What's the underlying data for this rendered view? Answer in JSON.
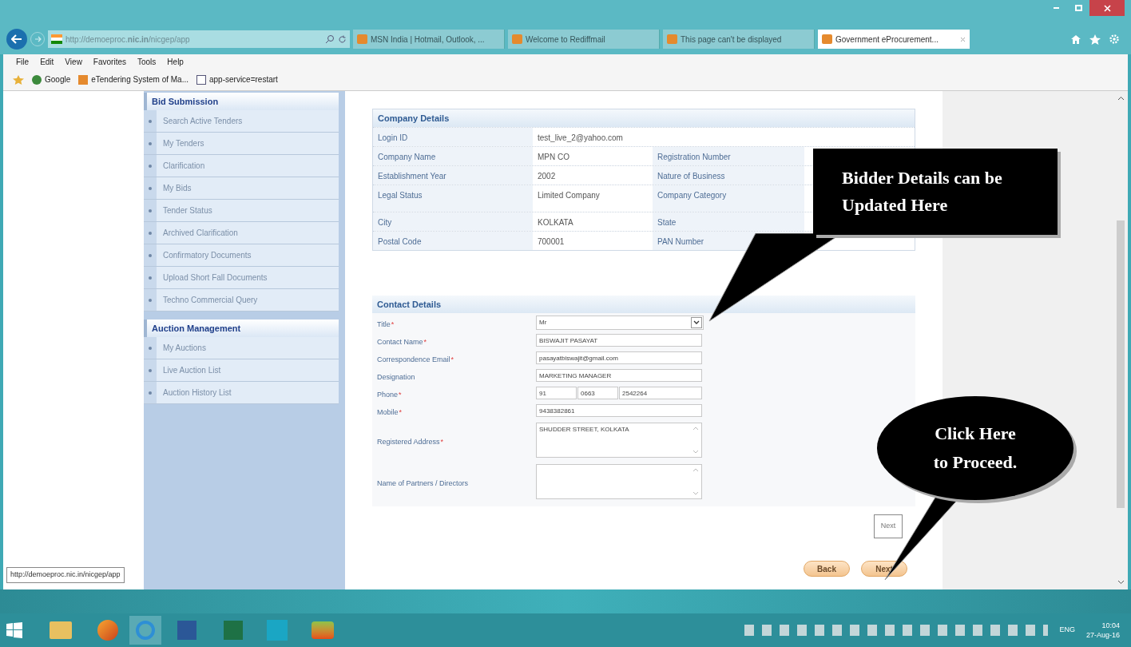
{
  "browser": {
    "address": "http://demoeproc.**nic.in**/nicgep/app",
    "tabs": [
      {
        "label": "MSN India | Hotmail, Outlook, ...",
        "selected": false
      },
      {
        "label": "Welcome to Rediffmail",
        "selected": false
      },
      {
        "label": "This page can't be displayed",
        "selected": false
      },
      {
        "label": "Government eProcurement...",
        "selected": true
      }
    ],
    "menu": [
      "File",
      "Edit",
      "View",
      "Favorites",
      "Tools",
      "Help"
    ],
    "favorites": [
      "Google",
      "eTendering System of Ma...",
      "app-service=restart"
    ]
  },
  "sidebar": [
    {
      "title": "Bid Submission",
      "items": [
        "Search Active Tenders",
        "My Tenders",
        "Clarification",
        "My Bids",
        "Tender Status",
        "Archived Clarification",
        "Confirmatory Documents",
        "Upload Short Fall Documents",
        "Techno Commercial Query"
      ]
    },
    {
      "title": "Auction Management",
      "items": [
        "My Auctions",
        "Live Auction List",
        "Auction History List"
      ]
    }
  ],
  "company": {
    "title": "Company Details",
    "rows": [
      {
        "label": "Login ID",
        "value": "test_live_2@yahoo.com"
      },
      {
        "label": "Company Name",
        "value": "MPN CO",
        "label2": "Registration Number"
      },
      {
        "label": "Establishment Year",
        "value": "2002",
        "label2": "Nature of Business"
      },
      {
        "label": "Legal Status",
        "value": "Limited Company",
        "label2": "Company Category"
      },
      {
        "label": "City",
        "value": "KOLKATA",
        "label2": "State"
      },
      {
        "label": "Postal Code",
        "value": "700001",
        "label2": "PAN Number"
      }
    ]
  },
  "contact": {
    "title": "Contact Details",
    "fields": [
      {
        "label": "Title",
        "mark": "*",
        "kind": "select",
        "values": [
          "Mr"
        ]
      },
      {
        "label": "Contact Name",
        "mark": "*",
        "kind": "text",
        "values": [
          "BISWAJIT PASAYAT"
        ]
      },
      {
        "label": "Correspondence Email",
        "mark": "*",
        "kind": "text",
        "values": [
          "pasayatbiswajit@gmail.com"
        ]
      },
      {
        "label": "Designation",
        "kind": "text",
        "values": [
          "MARKETING MANAGER"
        ]
      },
      {
        "label": "Phone",
        "mark": "*",
        "kind": "phone",
        "values": [
          "91",
          "0663",
          "2542264"
        ]
      },
      {
        "label": "Mobile",
        "mark": "*",
        "kind": "text",
        "values": [
          "9438382861"
        ]
      },
      {
        "label": "Registered Address",
        "mark": "*",
        "kind": "textarea",
        "values": [
          "SHUDDER STREET, KOLKATA"
        ]
      },
      {
        "label": "Name of Partners / Directors",
        "kind": "textarea"
      }
    ]
  },
  "next_top": "Next",
  "buttons": [
    "Back",
    "Next"
  ],
  "callouts": [
    {
      "kind": "box",
      "text": "Bidder Details can be Updated Here"
    },
    {
      "kind": "oval",
      "text": "Click Here to Proceed."
    }
  ],
  "status_url": "http://demoeproc.nic.in/nicgep/app",
  "tray": {
    "language": "ENG",
    "time": "10:04",
    "date": "27-Aug-16"
  }
}
